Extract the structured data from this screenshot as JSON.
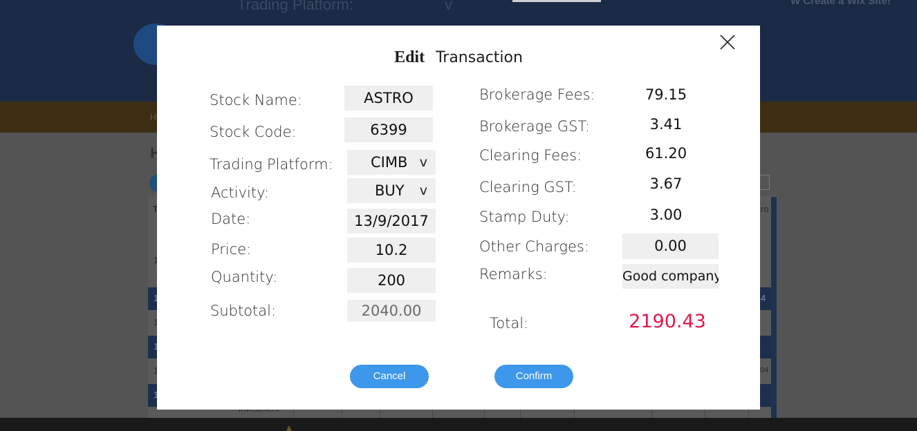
{
  "background": {
    "header_title": "Trading Platform:",
    "header_caret": "v",
    "header_link": "W Create a Wix Site!",
    "nav_item": "H",
    "heading": "H",
    "col_head_left": "T",
    "col_head_right": "ro",
    "row_cells": [
      "1",
      "1",
      "1",
      "1",
      "1",
      "1",
      "1"
    ],
    "row_values_right": [
      "4",
      "04"
    ],
    "footer_text": "Investment"
  },
  "modal": {
    "title_edit": "Edit",
    "title_transaction": "Transaction",
    "close_icon": "close-icon",
    "left": {
      "stock_name_label": "Stock Name:",
      "stock_name_value": "ASTRO",
      "stock_code_label": "Stock Code:",
      "stock_code_value": "6399",
      "platform_label": "Trading Platform:",
      "platform_value": "CIMB",
      "activity_label": "Activity:",
      "activity_value": "BUY",
      "dropdown_caret": "v",
      "date_label": "Date:",
      "date_value": "13/9/2017",
      "price_label": "Price:",
      "price_value": "10.2",
      "quantity_label": "Quantity:",
      "quantity_value": "200",
      "subtotal_label": "Subtotal:",
      "subtotal_value": "2040.00"
    },
    "right": {
      "brokerage_fees_label": "Brokerage Fees:",
      "brokerage_fees_value": "79.15",
      "brokerage_gst_label": "Brokerage GST:",
      "brokerage_gst_value": "3.41",
      "clearing_fees_label": "Clearing Fees:",
      "clearing_fees_value": "61.20",
      "clearing_gst_label": "Clearing GST:",
      "clearing_gst_value": "3.67",
      "stamp_duty_label": "Stamp Duty:",
      "stamp_duty_value": "3.00",
      "other_charges_label": "Other Charges:",
      "other_charges_value": "0.00",
      "remarks_label": "Remarks:",
      "remarks_value": "Good company"
    },
    "total_label": "Total:",
    "total_value": "2190.43",
    "cancel_label": "Cancel",
    "confirm_label": "Confirm"
  },
  "colors": {
    "accent_button": "#3d97ea",
    "total_value": "#e0174a",
    "field_background": "#efefef",
    "overlay_header": "#1b2a45"
  }
}
